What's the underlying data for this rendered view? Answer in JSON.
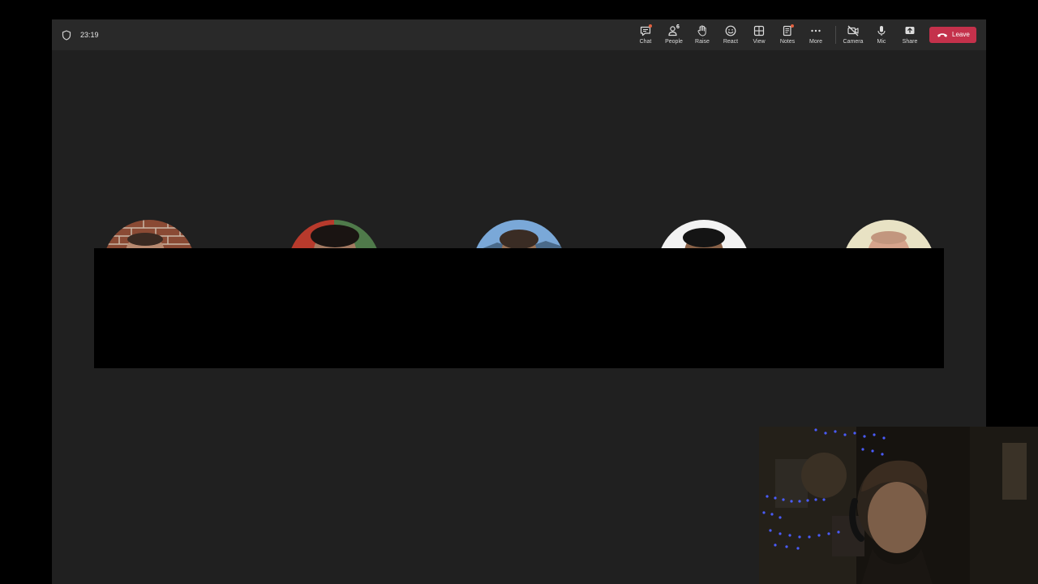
{
  "meeting": {
    "timer": "23:19"
  },
  "toolbar": {
    "chat": "Chat",
    "people": "People",
    "people_count": "6",
    "raise": "Raise",
    "react": "React",
    "view": "View",
    "notes": "Notes",
    "more": "More",
    "camera": "Camera",
    "mic": "Mic",
    "share": "Share",
    "leave": "Leave"
  },
  "colors": {
    "background": "#202020",
    "topbar": "#292929",
    "leave_button": "#c4314b",
    "notification_dot": "#e2603f"
  },
  "participants": [
    {
      "avatar": "participant-avatar",
      "background": "brick-wall"
    },
    {
      "avatar": "participant-avatar",
      "background": "red-green"
    },
    {
      "avatar": "participant-avatar",
      "background": "sky-blue"
    },
    {
      "avatar": "participant-avatar",
      "background": "white"
    },
    {
      "avatar": "participant-avatar",
      "background": "cream"
    }
  ],
  "icons": [
    "shield-icon",
    "chat-icon",
    "people-icon",
    "raise-hand-icon",
    "react-icon",
    "view-icon",
    "notes-icon",
    "more-icon",
    "camera-off-icon",
    "mic-icon",
    "share-icon",
    "hang-up-icon"
  ]
}
